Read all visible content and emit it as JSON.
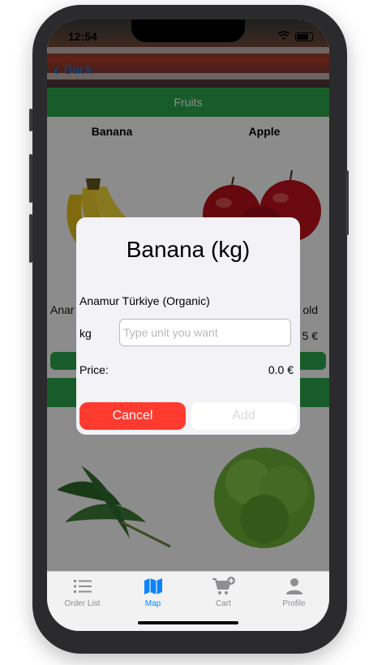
{
  "status_bar": {
    "time": "12:54"
  },
  "nav": {
    "back_label": "Back"
  },
  "section": {
    "title": "Fruits"
  },
  "products": [
    {
      "name": "Banana",
      "origin_partial": "Anar"
    },
    {
      "name": "Apple",
      "origin_partial": "old",
      "price_partial": "5 €"
    }
  ],
  "dialog": {
    "title": "Banana (kg)",
    "origin": "Anamur Türkiye (Organic)",
    "unit_label": "kg",
    "unit_placeholder": "Type unit you want",
    "unit_value": "",
    "price_label": "Price:",
    "price_value": "0.0 €",
    "cancel_label": "Cancel",
    "add_label": "Add"
  },
  "tabs": [
    {
      "label": "Order List",
      "icon": "list-icon",
      "active": false
    },
    {
      "label": "Map",
      "icon": "map-icon",
      "active": true
    },
    {
      "label": "Cart",
      "icon": "cart-plus-icon",
      "active": false
    },
    {
      "label": "Profile",
      "icon": "person-icon",
      "active": false
    }
  ],
  "colors": {
    "accent": "#0a84ff",
    "section_green": "#2fa84f",
    "cancel_red": "#ff3b30"
  }
}
